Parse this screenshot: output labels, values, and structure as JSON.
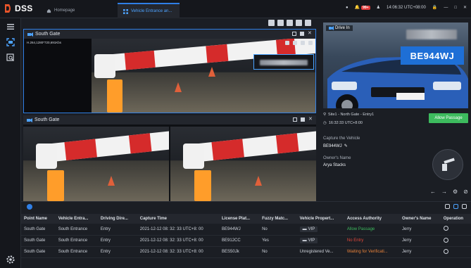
{
  "app": {
    "name": "DSS"
  },
  "tabs": [
    {
      "label": "Homepage",
      "icon": "home-icon"
    },
    {
      "label": "Vehicle Entrance an...",
      "icon": "grid-icon"
    }
  ],
  "topbar": {
    "alarm_badge": "99+",
    "time": "14:06:32 UTC+08:00"
  },
  "panes": [
    {
      "title": "South Gate",
      "osd": "H.264,1280*720,691Kbs"
    },
    {
      "title": "South Gate"
    }
  ],
  "detail": {
    "direction": "Drive In",
    "plate": "BE944WJ",
    "location": "Site1 - North Gate - Entry1",
    "time": "16:32:33 UTC+8:00",
    "allow_label": "Allow Passage",
    "capture_label": "Capture the Vehicle",
    "capture_value": "BE944WJ",
    "owner_label": "Owner's Name",
    "owner_value": "Arya Stacks",
    "colors": {
      "plate_bg": "#1e6fd6",
      "allow": "#3dbb5e"
    }
  },
  "table": {
    "headers": [
      "Point Name",
      "Vehicle Entra...",
      "Driving Dire...",
      "Capture Time",
      "License Plat...",
      "Fuzzy Matc...",
      "Vehicle Propert...",
      "Access Authority",
      "Owner's Name",
      "Operation"
    ],
    "rows": [
      {
        "point": "South Gate",
        "entrance": "South Entrance",
        "direction": "Entry",
        "time": "2021-12-12 08: 32: 33 UTC+8: 00",
        "plate": "BE944WJ",
        "fuzzy": "No",
        "property": "VIP",
        "authority": "Allow Passage",
        "authority_color": "green",
        "owner": "Jerry"
      },
      {
        "point": "South Gate",
        "entrance": "South Entrance",
        "direction": "Entry",
        "time": "2021-12-12 08: 32: 33 UTC+8: 00",
        "plate": "BE912CC",
        "fuzzy": "Yes",
        "property": "VIP",
        "authority": "No Entry",
        "authority_color": "red",
        "owner": "Jerry"
      },
      {
        "point": "South Gate",
        "entrance": "South Entrance",
        "direction": "Entry",
        "time": "2021-12-12 08: 32: 33 UTC+8: 00",
        "plate": "BES50Jk",
        "fuzzy": "No",
        "property": "Unregistered Ve...",
        "authority": "Waiting for Verificati...",
        "authority_color": "orange",
        "owner": "Jerry"
      }
    ]
  }
}
